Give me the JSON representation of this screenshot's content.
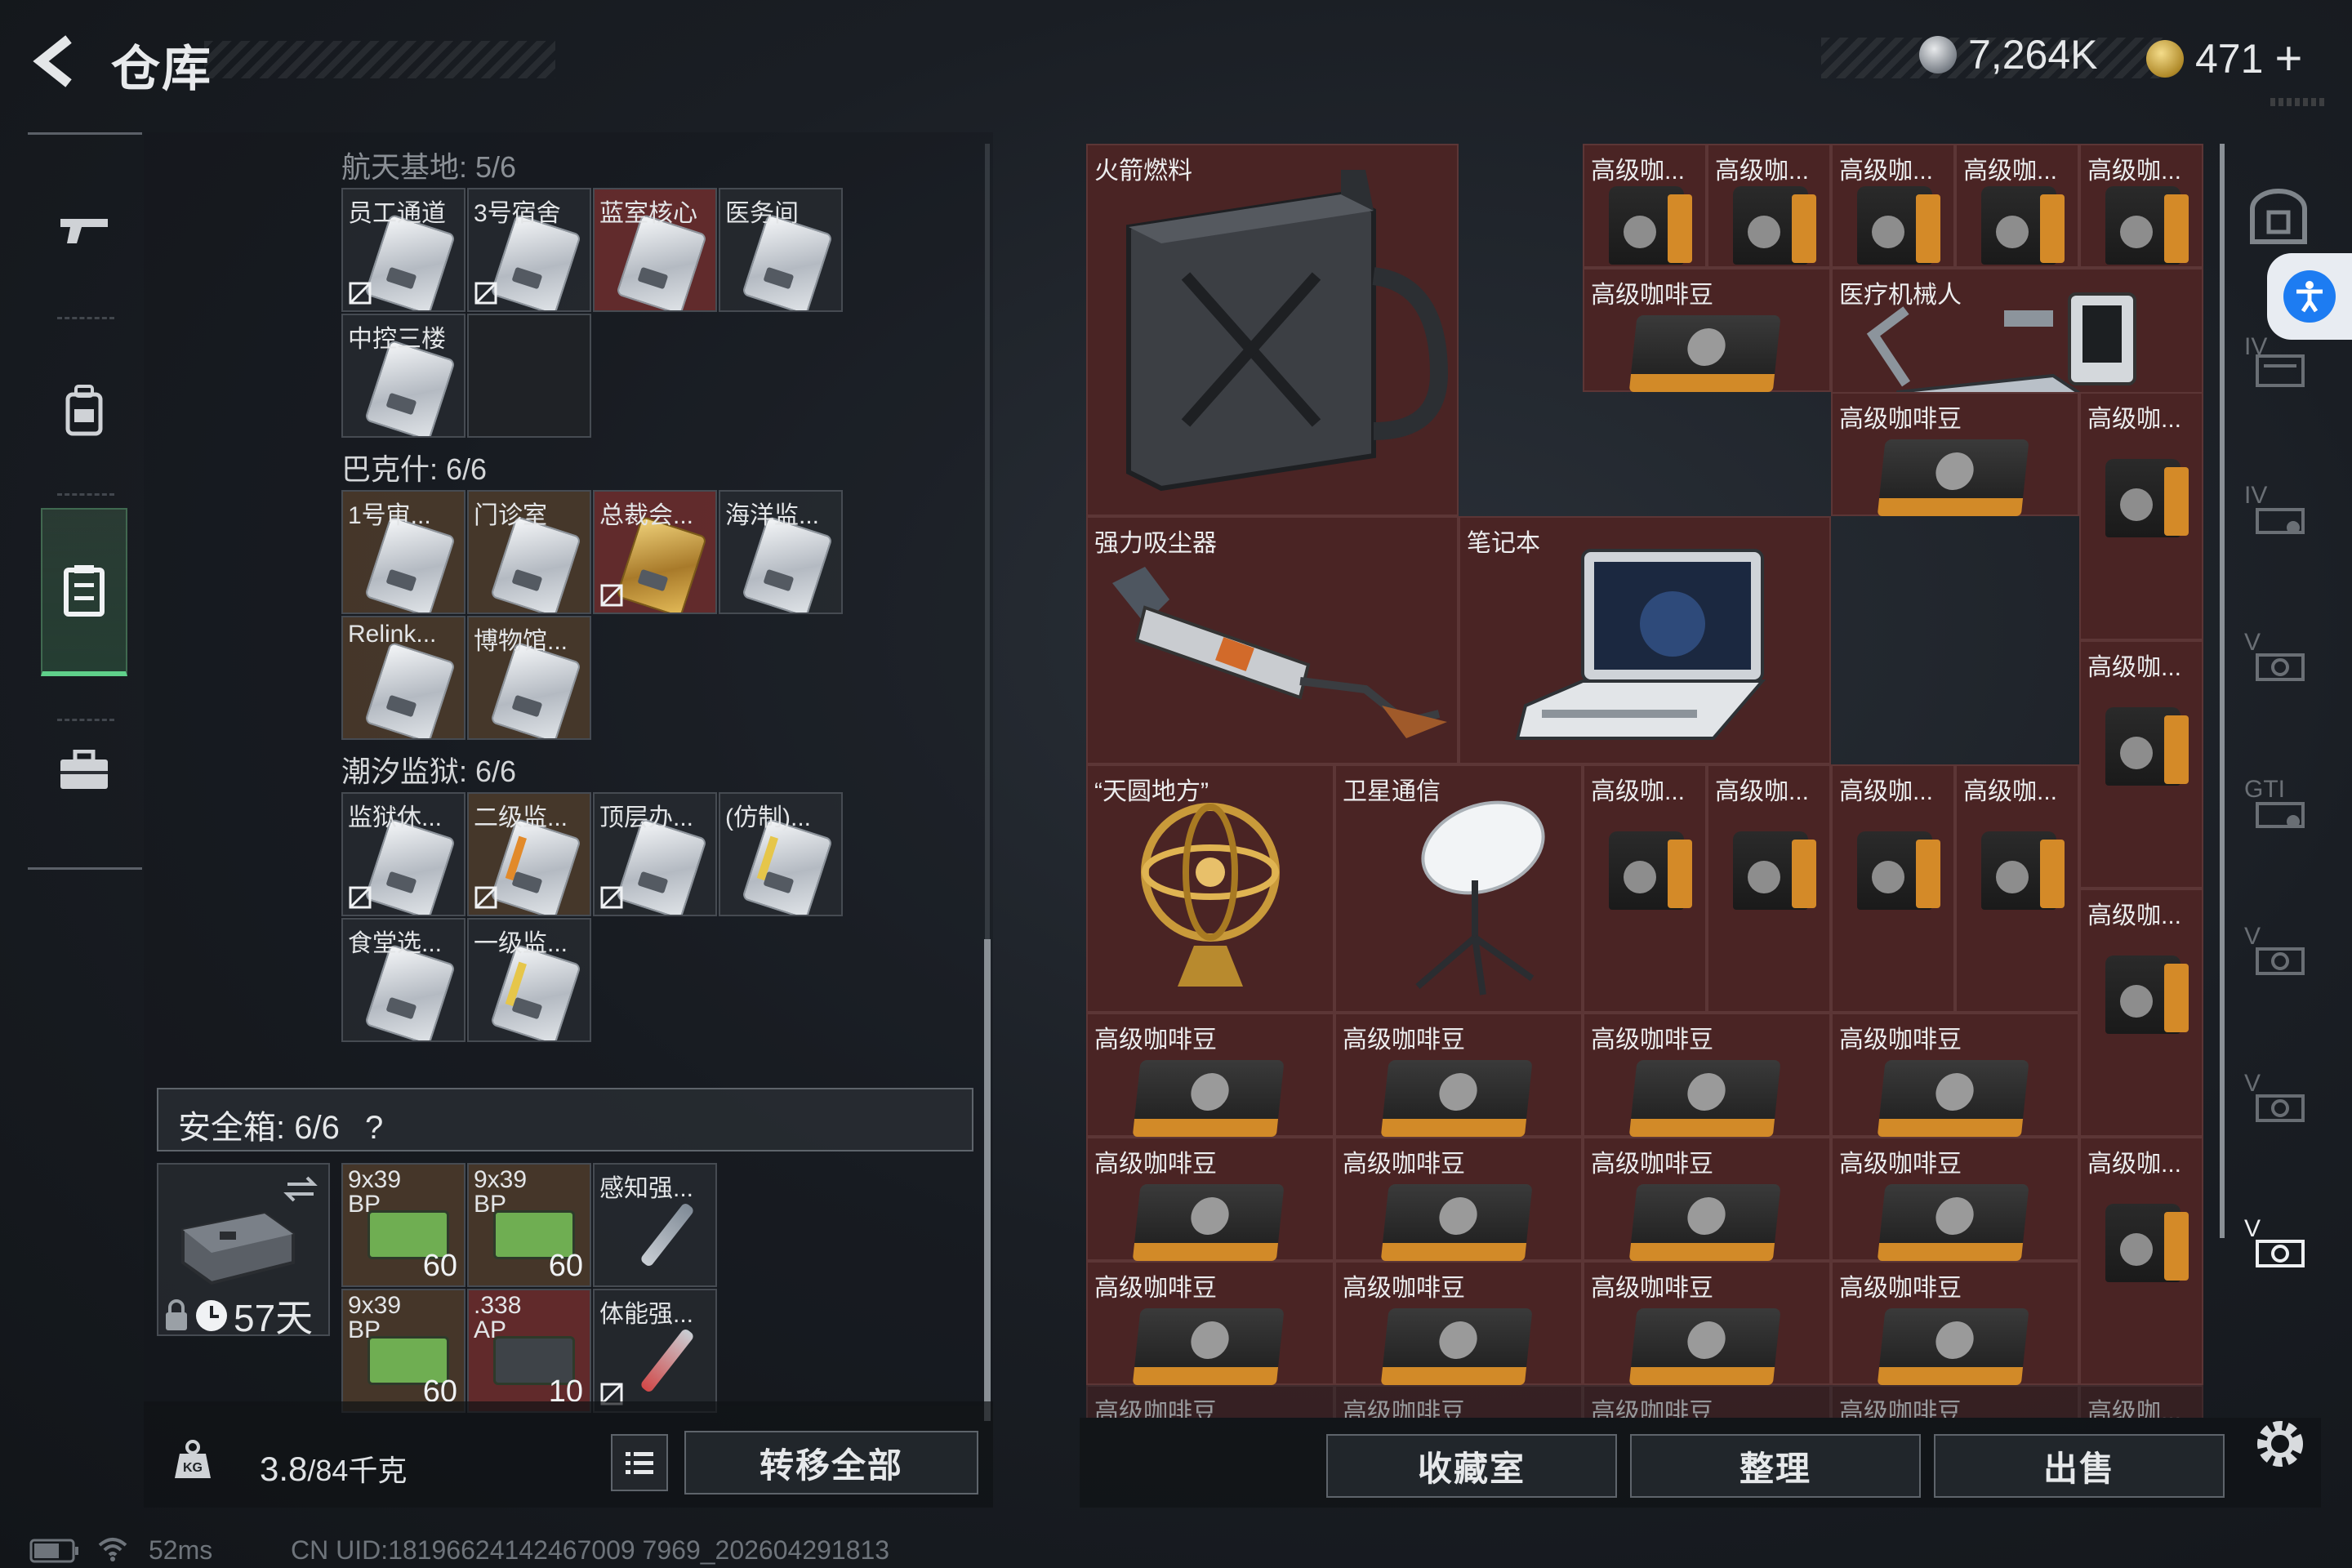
{
  "header": {
    "title": "仓库",
    "currency_1": "7,264K",
    "currency_2": "471",
    "currency_2_add": "+"
  },
  "left_nav": {
    "items": [
      {
        "name": "weapon",
        "icon": "gun-icon"
      },
      {
        "name": "gear",
        "icon": "backpack-icon"
      },
      {
        "name": "storage",
        "icon": "locker-icon",
        "active": true
      },
      {
        "name": "case",
        "icon": "briefcase-icon"
      }
    ]
  },
  "keys": {
    "groups": [
      {
        "title": "航天基地: 5/6",
        "items": [
          "员工通道",
          "3号宿舍",
          "蓝室核心",
          "医务间",
          "中控三楼"
        ]
      },
      {
        "title": "巴克什: 6/6",
        "items": [
          "1号审...",
          "门诊室",
          "总裁会...",
          "海洋监...",
          "Relink...",
          "博物馆..."
        ]
      },
      {
        "title": "潮汐监狱: 6/6",
        "items": [
          "监狱休...",
          "二级监...",
          "顶层办...",
          "(仿制)...",
          "食堂选...",
          "一级监..."
        ]
      }
    ]
  },
  "safe_box": {
    "label": "安全箱:  6/6",
    "help": "?",
    "timer": "57天",
    "items": [
      {
        "label": "9x39\nBP",
        "qty": "60"
      },
      {
        "label": "9x39\nBP",
        "qty": "60"
      },
      {
        "label": "感知强...",
        "qty": ""
      },
      {
        "label": "9x39\nBP",
        "qty": "60"
      },
      {
        "label": ".338\nAP",
        "qty": "10"
      },
      {
        "label": "体能强...",
        "qty": ""
      }
    ]
  },
  "bottom_left": {
    "weight": "3.8",
    "weight_total": "/84千克",
    "transfer_all": "转移全部"
  },
  "storage": {
    "items": {
      "rocket_fuel": "火箭燃料",
      "vacuum": "强力吸尘器",
      "laptop": "笔记本",
      "medbot": "医疗机械人",
      "armillary": "“天圆地方”",
      "satellite": "卫星通信",
      "coffee_short": "高级咖...",
      "coffee_full": "高级咖啡豆"
    }
  },
  "bottom_right": {
    "collection": "收藏室",
    "sort": "整理",
    "sell": "出售"
  },
  "status_bar": {
    "ping": "52ms",
    "uid": "CN UID:18196624142467009 7969_202604291813"
  },
  "side_tabs": [
    "IV",
    "IV",
    "V",
    "GTI",
    "V",
    "V",
    "V"
  ]
}
